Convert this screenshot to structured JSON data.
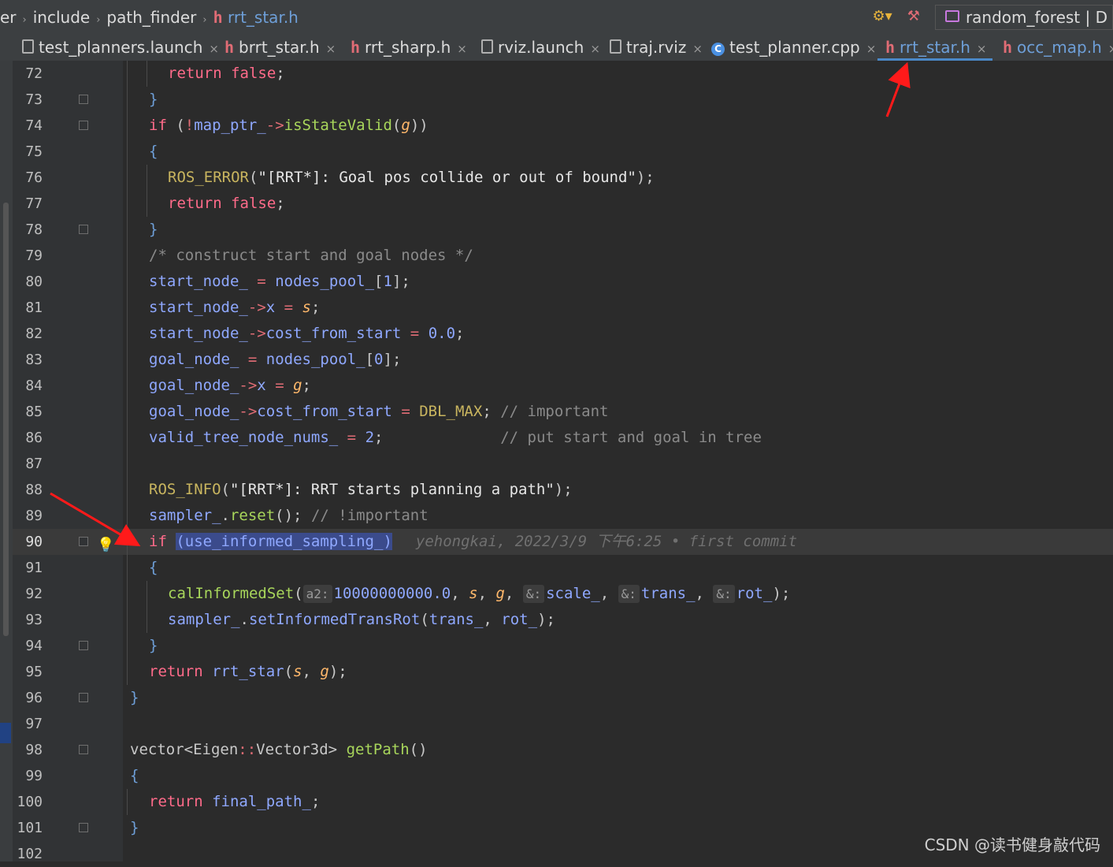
{
  "breadcrumbs": {
    "items": [
      "er",
      "include",
      "path_finder",
      "rrt_star.h"
    ],
    "h_glyph": "h"
  },
  "toolbar": {
    "run_config": "random_forest | D"
  },
  "tabs": [
    {
      "label": "test_planners.launch",
      "icon": "document-icon",
      "active": false
    },
    {
      "label": "brrt_star.h",
      "icon": "header-h-icon",
      "active": false
    },
    {
      "label": "rrt_sharp.h",
      "icon": "header-h-icon",
      "active": false
    },
    {
      "label": "rviz.launch",
      "icon": "document-icon",
      "active": false
    },
    {
      "label": "traj.rviz",
      "icon": "document-icon",
      "active": false
    },
    {
      "label": "test_planner.cpp",
      "icon": "cpp-icon",
      "active": false
    },
    {
      "label": "rrt_star.h",
      "icon": "header-h-icon",
      "active": true
    },
    {
      "label": "occ_map.h",
      "icon": "header-h-icon",
      "active": false
    }
  ],
  "tab_close_glyph": "×",
  "cpp_glyph": "C",
  "line_numbers": [
    "72",
    "73",
    "74",
    "75",
    "76",
    "77",
    "78",
    "79",
    "80",
    "81",
    "82",
    "83",
    "84",
    "85",
    "86",
    "87",
    "88",
    "89",
    "90",
    "91",
    "92",
    "93",
    "94",
    "95",
    "96",
    "97",
    "98",
    "99",
    "100",
    "101",
    "102"
  ],
  "inline_hints": {
    "a2": "a2:",
    "amp": "&:"
  },
  "blame": "yehongkai, 2022/3/9 下午6:25 • first commit",
  "watermark": "CSDN @读书健身敲代码",
  "colors": {
    "keyword": "#ff6b8a",
    "field": "#8fa8ff",
    "param": "#ffb86b",
    "comment": "#8a8a8a",
    "arrow": "#ff1a1a"
  }
}
